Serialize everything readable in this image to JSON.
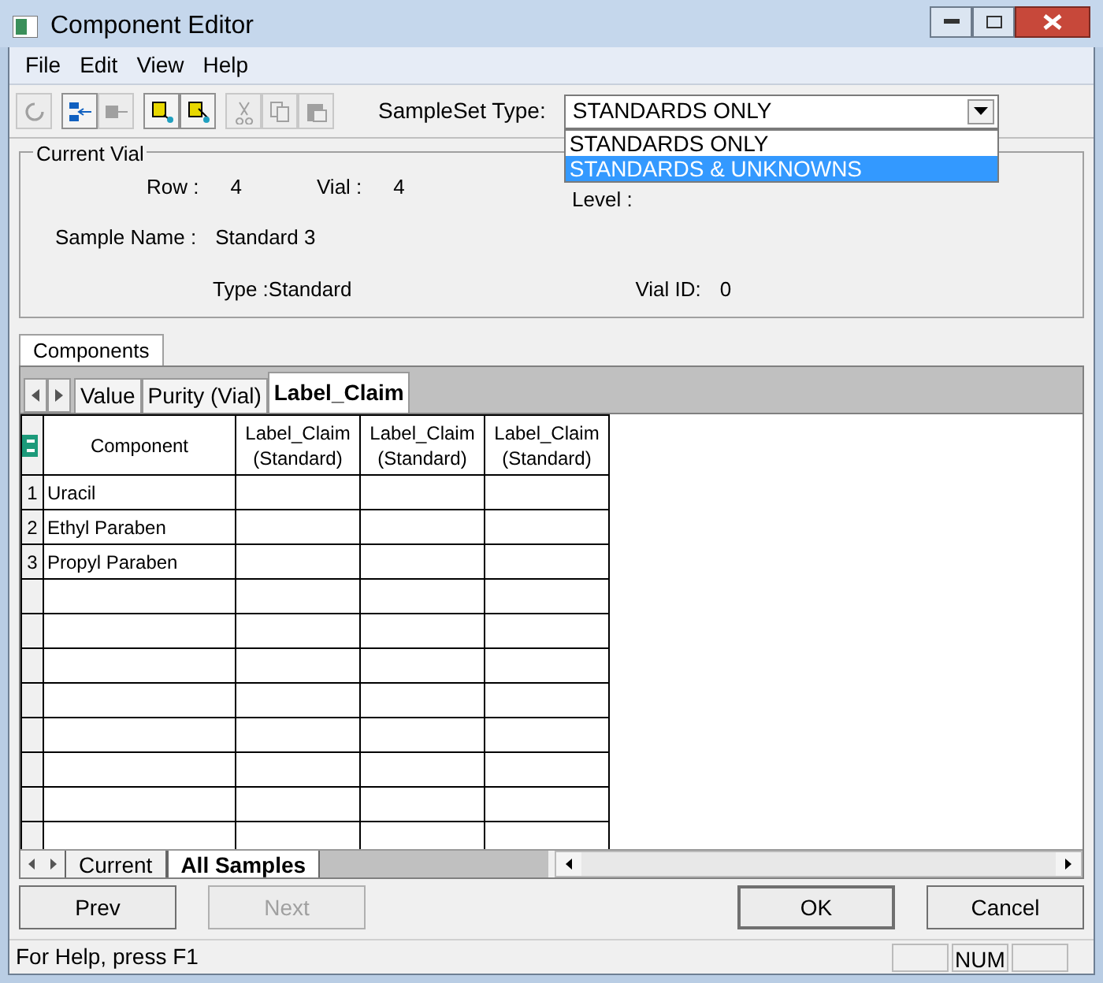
{
  "window": {
    "title": "Component Editor"
  },
  "menu": [
    "File",
    "Edit",
    "View",
    "Help"
  ],
  "toolbar": [
    {
      "kind": "refresh",
      "disabled": true
    },
    {
      "kind": "link",
      "disabled": false
    },
    {
      "kind": "unlink",
      "disabled": true
    },
    {
      "kind": "export",
      "disabled": false
    },
    {
      "kind": "import",
      "disabled": false
    },
    {
      "kind": "cut",
      "disabled": true
    },
    {
      "kind": "copy",
      "disabled": true
    },
    {
      "kind": "paste",
      "disabled": true
    }
  ],
  "sampleset": {
    "label": "SampleSet Type:",
    "value": "STANDARDS ONLY",
    "options": [
      {
        "label": "STANDARDS ONLY",
        "highlighted": false
      },
      {
        "label": "STANDARDS & UNKNOWNS",
        "highlighted": true
      }
    ]
  },
  "current_vial": {
    "title": "Current Vial",
    "row_label": "Row :",
    "row": "4",
    "vial_label": "Vial :",
    "vial": "4",
    "level_label": "Level :",
    "sample_name_label": "Sample Name :",
    "sample_name": "Standard 3",
    "type_label": "Type :",
    "type": "Standard",
    "vial_id_label": "Vial ID:",
    "vial_id": "0"
  },
  "outer_tab": "Components",
  "tabs": [
    {
      "label": "Value",
      "selected": false
    },
    {
      "label": "Purity (Vial)",
      "selected": false
    },
    {
      "label": "Label_Claim",
      "selected": true
    }
  ],
  "table": {
    "columns": [
      "Component",
      "Label_Claim (Standard)",
      "Label_Claim (Standard)",
      "Label_Claim (Standard)"
    ],
    "rows": [
      {
        "number": "1",
        "component": "Uracil"
      },
      {
        "number": "2",
        "component": "Ethyl Paraben"
      },
      {
        "number": "3",
        "component": "Propyl Paraben"
      }
    ]
  },
  "sheet_tabs": [
    {
      "label": "Current",
      "selected": false
    },
    {
      "label": "All Samples",
      "selected": true
    }
  ],
  "buttons": [
    {
      "label": "Prev",
      "disabled": false
    },
    {
      "label": "Next",
      "disabled": true
    },
    {
      "label": "OK",
      "disabled": false
    },
    {
      "label": "Cancel",
      "disabled": false
    }
  ],
  "status_bar": {
    "text": "For Help, press F1",
    "indicator": "NUM"
  }
}
